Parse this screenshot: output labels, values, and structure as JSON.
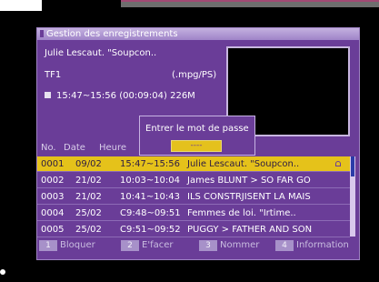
{
  "window_title": "Gestion des enregistrements",
  "info": {
    "program_title": "Julie Lescaut. \"Soupcon..",
    "channel": "TF1",
    "format": "(.mpg/PS)",
    "time_size": "15:47~15:56 (00:09:04) 226M"
  },
  "table": {
    "headers": {
      "no": "No.",
      "date": "Date",
      "heure": "Heure"
    },
    "rows": [
      {
        "no": "0001",
        "date": "09/02",
        "time": "15:47~15:56",
        "title": "Julie Lescaut. \"Soupcon..",
        "selected": true
      },
      {
        "no": "0002",
        "date": "21/02",
        "time": "10:03~10:04",
        "title": "James BLUNT > SO FAR GO"
      },
      {
        "no": "0003",
        "date": "21/02",
        "time": "10:41~10:43",
        "title": "ILS CONSTRJISENT LA MAIS"
      },
      {
        "no": "0004",
        "date": "25/02",
        "time": "C9:48~09:51",
        "title": "Femmes de loi. \"Irtime.."
      },
      {
        "no": "0005",
        "date": "25/02",
        "time": "C9:51~09:52",
        "title": "PUGGY > FATHER AND SON"
      }
    ]
  },
  "dialog": {
    "prompt": "Entrer le mot de passe",
    "field_value": "----"
  },
  "footer": [
    {
      "key": "1",
      "label": "Bloquer"
    },
    {
      "key": "2",
      "label": "E'facer"
    },
    {
      "key": "3",
      "label": "Nommer"
    },
    {
      "key": "4",
      "label": "Information"
    }
  ],
  "colors": {
    "background": "#6a3d98",
    "selection": "#e5c21a",
    "title_bar": "#b59fd6"
  },
  "scroll_position": 0.0
}
